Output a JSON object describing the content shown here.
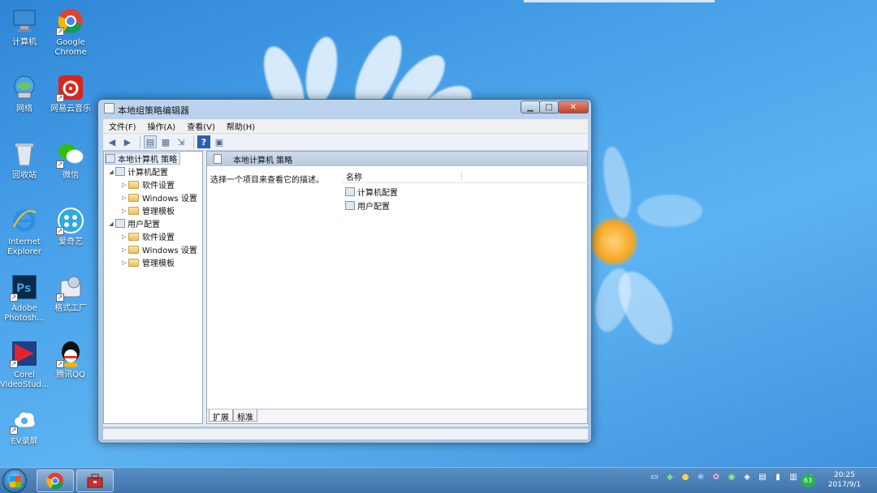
{
  "desktop": {
    "icons": [
      {
        "label": "计算机",
        "icon": "computer-icon"
      },
      {
        "label": "Google Chrome",
        "icon": "chrome-icon"
      },
      {
        "label": "网络",
        "icon": "network-icon"
      },
      {
        "label": "网易云音乐",
        "icon": "netease-music-icon"
      },
      {
        "label": "回收站",
        "icon": "recycle-bin-icon"
      },
      {
        "label": "微信",
        "icon": "wechat-icon"
      },
      {
        "label": "Internet Explorer",
        "icon": "ie-icon"
      },
      {
        "label": "爱奇艺",
        "icon": "video-player-icon"
      },
      {
        "label": "Adobe Photosh...",
        "icon": "photoshop-icon"
      },
      {
        "label": "格式工厂",
        "icon": "format-factory-icon"
      },
      {
        "label": "Corel VideoStud...",
        "icon": "corel-icon"
      },
      {
        "label": "腾讯QQ",
        "icon": "qq-icon"
      },
      {
        "label": "EV录屏",
        "icon": "ev-recorder-icon"
      }
    ]
  },
  "window": {
    "title": "本地组策略编辑器",
    "menu": [
      "文件(F)",
      "操作(A)",
      "查看(V)",
      "帮助(H)"
    ],
    "tree": {
      "root": "本地计算机 策略",
      "computer": "计算机配置",
      "computer_children": [
        "软件设置",
        "Windows 设置",
        "管理模板"
      ],
      "user": "用户配置",
      "user_children": [
        "软件设置",
        "Windows 设置",
        "管理模板"
      ]
    },
    "right": {
      "header": "本地计算机 策略",
      "description": "选择一个项目来查看它的描述。",
      "column_name": "名称",
      "items": [
        "计算机配置",
        "用户配置"
      ]
    },
    "tabs": [
      "扩展",
      "标准"
    ]
  },
  "taskbar": {
    "tray_badge": "63",
    "time": "20:25",
    "date": "2017/9/1"
  },
  "colors": {
    "accent": "#3f73ab",
    "close": "#c6402b"
  }
}
